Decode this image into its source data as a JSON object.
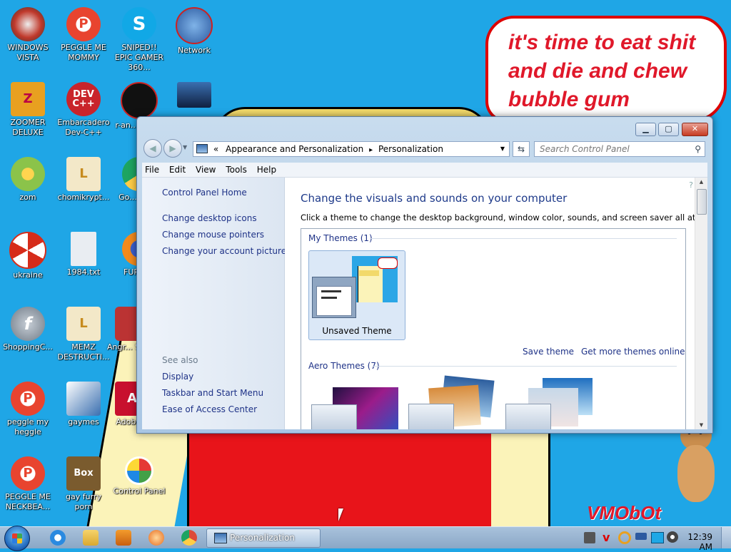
{
  "desktop": {
    "speech_bubble": "it's time to eat shit and die and chew bubble gum",
    "watermark": "VMObOt",
    "icons": [
      {
        "label": "WINDOWS VISTA",
        "icon": "vista-orb-icon",
        "color": "#c0392b"
      },
      {
        "label": "PEGGLE ME MOMMY",
        "icon": "peggle-icon",
        "color": "#e8442f"
      },
      {
        "label": "SNIPED!! EPIC GAMER 360...",
        "icon": "skype-icon",
        "color": "#11a8e6"
      },
      {
        "label": "Network",
        "icon": "network-globe-icon",
        "color": "#2c5aa0"
      },
      {
        "label": "ZOOMER DELUXE",
        "icon": "zoomer-icon",
        "color": "#e8a020"
      },
      {
        "label": "Embarcadero Dev-C++",
        "icon": "devcpp-icon",
        "color": "#c9242b"
      },
      {
        "label": "r-an... parl...",
        "icon": "red-circle-icon",
        "color": "#111"
      },
      {
        "label": "",
        "icon": "monitor-icon",
        "color": "#234"
      },
      {
        "label": "zom",
        "icon": "flower-icon",
        "color": "#8bc34a"
      },
      {
        "label": "chomikrypt...",
        "icon": "clock-file-icon",
        "color": "#c78b1e"
      },
      {
        "label": "Go... Chr...",
        "icon": "chrome-icon",
        "color": "#dd4b39"
      },
      {
        "label": "ukraine",
        "icon": "radiation-icon",
        "color": "#d62c1a"
      },
      {
        "label": "1984.txt",
        "icon": "text-file-icon",
        "color": "#e9edf2"
      },
      {
        "label": "FURRY...",
        "icon": "firefox-icon",
        "color": "#f28a1d"
      },
      {
        "label": "ShoppingC...",
        "icon": "flash-icon",
        "color": "#6f7a86"
      },
      {
        "label": "MEMZ DESTRUCTI...",
        "icon": "clock-file-icon",
        "color": "#c78b1e"
      },
      {
        "label": "Angr... Sea...",
        "icon": "angry-birds-icon",
        "color": "#b33"
      },
      {
        "label": "peggle my heggle",
        "icon": "peggle-icon",
        "color": "#e8442f"
      },
      {
        "label": "gaymes",
        "icon": "games-folder-icon",
        "color": "#3a6fb0"
      },
      {
        "label": "Adobe...",
        "icon": "adobe-icon",
        "color": "#c8102e"
      },
      {
        "label": "PEGGLE ME NECKBEA...",
        "icon": "peggle-icon",
        "color": "#e8442f"
      },
      {
        "label": "gay furry porn",
        "icon": "box-beaver-icon",
        "color": "#7a5b2e"
      },
      {
        "label": "Control Panel",
        "icon": "control-panel-icon",
        "color": "#3d7f3a"
      }
    ]
  },
  "window": {
    "address": {
      "prefix": "«",
      "part1": "Appearance and Personalization",
      "sep": "▸",
      "part2": "Personalization"
    },
    "search_placeholder": "Search Control Panel",
    "menu": [
      "File",
      "Edit",
      "View",
      "Tools",
      "Help"
    ],
    "sidebar": {
      "home": "Control Panel Home",
      "links": [
        "Change desktop icons",
        "Change mouse pointers",
        "Change your account picture"
      ],
      "see_also": "See also",
      "see_also_links": [
        "Display",
        "Taskbar and Start Menu",
        "Ease of Access Center"
      ]
    },
    "main": {
      "heading": "Change the visuals and sounds on your computer",
      "subheading": "Click a theme to change the desktop background, window color, sounds, and screen saver all at once.",
      "my_themes": "My Themes (1)",
      "unsaved_theme": "Unsaved Theme",
      "save_theme": "Save theme",
      "more_themes": "Get more themes online",
      "aero_themes": "Aero Themes (7)"
    }
  },
  "taskbar": {
    "active_window": "Personalization",
    "clock": "12:39 AM",
    "tray_icons": [
      "antivirus-icon",
      "v-icon",
      "search-icon",
      "key-icon",
      "monitor-icon",
      "speaker-icon"
    ]
  }
}
